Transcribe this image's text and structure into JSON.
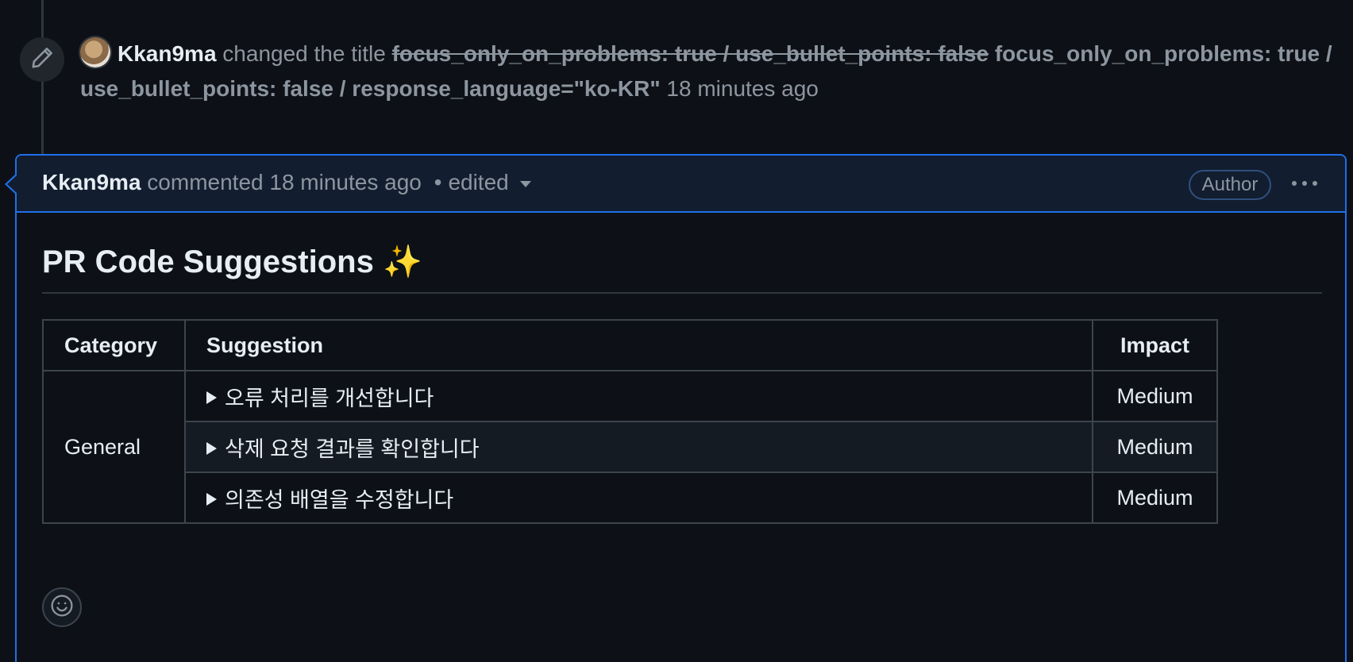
{
  "title_change_event": {
    "actor": "Kkan9ma",
    "action": "changed the title",
    "old_title": "focus_only_on_problems: true / use_bullet_points: false",
    "new_title": "focus_only_on_problems: true / use_bullet_points: false / response_language=\"ko-KR\"",
    "time": "18 minutes ago"
  },
  "comment": {
    "author": "Kkan9ma",
    "action": "commented",
    "time": "18 minutes ago",
    "separator": "•",
    "edited_label": "edited",
    "badge": "Author",
    "title": "PR Code Suggestions",
    "title_emoji": "✨",
    "table": {
      "headers": [
        "Category",
        "Suggestion",
        "Impact"
      ],
      "category": "General",
      "rows": [
        {
          "suggestion": "오류 처리를 개선합니다",
          "impact": "Medium"
        },
        {
          "suggestion": "삭제 요청 결과를 확인합니다",
          "impact": "Medium"
        },
        {
          "suggestion": "의존성 배열을 수정합니다",
          "impact": "Medium"
        }
      ]
    }
  },
  "icons": {
    "event": "pencil-icon",
    "menu": "kebab-horizontal-icon",
    "reaction": "smiley-icon",
    "edited_menu": "triangle-down-icon",
    "row_expand": "triangle-right-icon"
  },
  "colors": {
    "background": "#0d1117",
    "header_background": "#121d2f",
    "accent_border": "#1f6feb",
    "muted_text": "#8d96a0",
    "primary_text": "#e6edf3"
  }
}
